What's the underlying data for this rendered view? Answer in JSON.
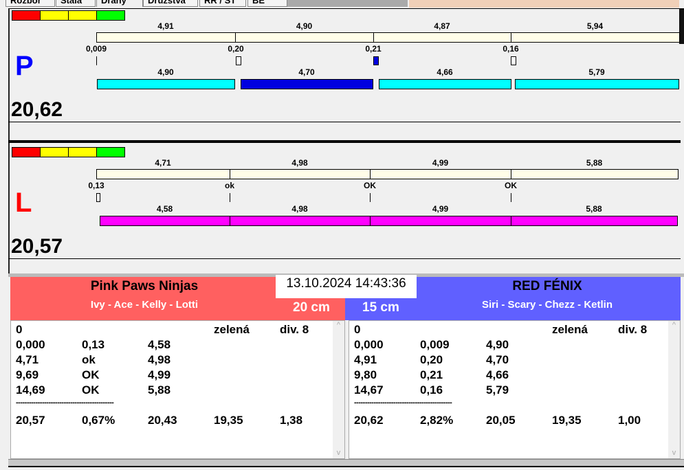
{
  "tabs": [
    "Rozbor",
    "Stála",
    "Dráhy",
    "Družstva",
    "RR / ST",
    "BE"
  ],
  "legend_colors": [
    "#ff0000",
    "#ffff00",
    "#ffff00",
    "#00ff00"
  ],
  "lanes": [
    {
      "side": "P",
      "side_color": "#0000ff",
      "total": "20,62",
      "top_values": [
        "4,91",
        "4,90",
        "4,87",
        "5,94"
      ],
      "reactions": [
        "0,009",
        "0,20",
        "0,21",
        "0,16"
      ],
      "bottom_values": [
        "4,90",
        "4,70",
        "4,66",
        "5,79"
      ],
      "bar_colors": [
        "#00ffff",
        "#0000e0",
        "#00ffff",
        "#00ffff"
      ]
    },
    {
      "side": "L",
      "side_color": "#ff0000",
      "total": "20,57",
      "top_values": [
        "4,71",
        "4,98",
        "4,99",
        "5,88"
      ],
      "reactions": [
        "0,13",
        "ok",
        "OK",
        "OK"
      ],
      "bottom_values": [
        "4,58",
        "4,98",
        "4,99",
        "5,88"
      ],
      "bar_colors": [
        "#ff00ff",
        "#ff00ff",
        "#ff00ff",
        "#ff00ff"
      ]
    }
  ],
  "datetime": "13.10.2024 14:43:36",
  "left_team": {
    "name": "Pink Paws Ninjas",
    "players": "Ivy - Ace - Kelly - Lotti",
    "distance": "20 cm",
    "color": "#ff6060",
    "rows": [
      [
        "0",
        "",
        "",
        "zelená",
        "div. 8"
      ],
      [
        "0,000",
        "0,13",
        "4,58",
        "",
        ""
      ],
      [
        "4,71",
        "ok",
        "4,98",
        "",
        ""
      ],
      [
        "9,69",
        "OK",
        "4,99",
        "",
        ""
      ],
      [
        "14,69",
        "OK",
        "5,88",
        "",
        ""
      ]
    ],
    "separator": "---------------------------------------------",
    "totals": [
      "20,57",
      "0,67%",
      "20,43",
      "19,35",
      "1,38"
    ]
  },
  "right_team": {
    "name": "RED FÉNIX",
    "players": "Siri - Scary - Chezz - Ketlin",
    "distance": "15 cm",
    "color": "#6060ff",
    "rows": [
      [
        "0",
        "",
        "",
        "zelená",
        "div. 8"
      ],
      [
        "0,000",
        "0,009",
        "4,90",
        "",
        ""
      ],
      [
        "4,91",
        "0,20",
        "4,70",
        "",
        ""
      ],
      [
        "9,80",
        "0,21",
        "4,66",
        "",
        ""
      ],
      [
        "14,67",
        "0,16",
        "5,79",
        "",
        ""
      ]
    ],
    "separator": "---------------------------------------------",
    "totals": [
      "20,62",
      "2,82%",
      "20,05",
      "19,35",
      "1,00"
    ]
  }
}
